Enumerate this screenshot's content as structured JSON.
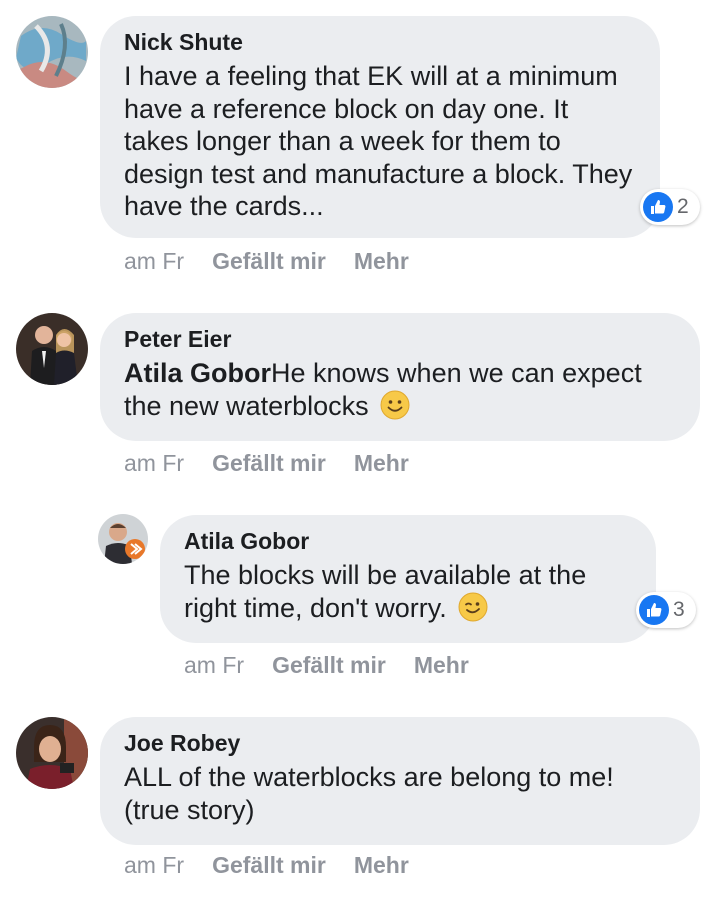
{
  "comments": [
    {
      "author": "Nick Shute",
      "text": "I have a feeling that EK will at a minimum have a reference block on day one. It takes longer than a week for them to design test and manufacture a block. They have the cards...",
      "time": "am Fr",
      "like_label": "Gefällt mir",
      "more_label": "Mehr",
      "reaction_icon": "thumbs-up-icon",
      "reaction_count": "2"
    },
    {
      "author": "Peter Eier",
      "mention": "Atila Gobor",
      "text": "He knows when we can expect the new waterblocks",
      "emoji": "smile-emoji",
      "time": "am Fr",
      "like_label": "Gefällt mir",
      "more_label": "Mehr"
    },
    {
      "author": "Atila Gobor",
      "text": "The blocks will be available at the right time, don't worry.",
      "emoji": "wink-emoji",
      "time": "am Fr",
      "like_label": "Gefällt mir",
      "more_label": "Mehr",
      "reaction_icon": "thumbs-up-icon",
      "reaction_count": "3"
    },
    {
      "author": "Joe Robey",
      "text": "ALL of the waterblocks are belong to me! (true story)",
      "time": "am Fr",
      "like_label": "Gefällt mir",
      "more_label": "Mehr"
    }
  ],
  "colors": {
    "bubble": "#ebedf0",
    "action_text": "#90949c",
    "like_blue": "#1877f2"
  }
}
